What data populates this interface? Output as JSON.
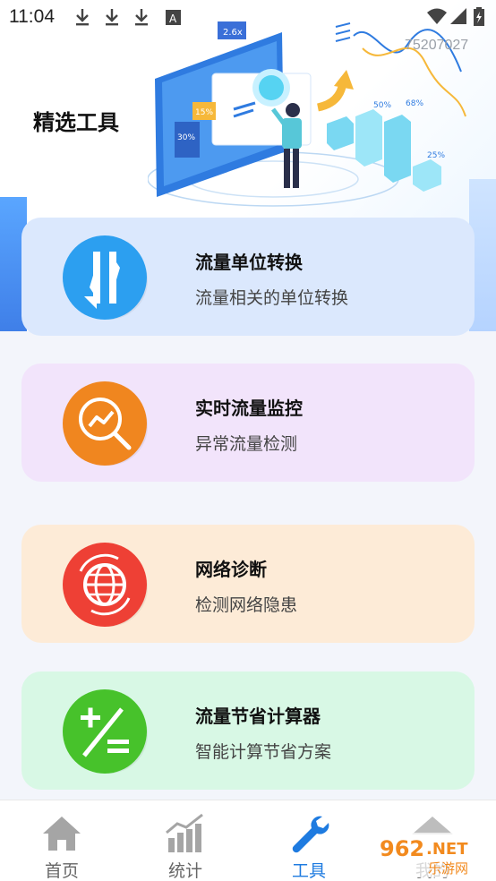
{
  "status_bar": {
    "time": "11:04",
    "left_icons": [
      "download-icon",
      "download-icon",
      "download-icon",
      "font-icon"
    ],
    "right_icons": [
      "wifi-icon",
      "signal-icon",
      "battery-icon"
    ]
  },
  "header": {
    "title": "精选工具",
    "code": "75207027"
  },
  "cards": [
    {
      "title": "流量单位转换",
      "desc": "流量相关的单位转换",
      "bg": "#dbe8fd",
      "icon_color": "#2c9ff0",
      "icon": "swap-arrows-icon"
    },
    {
      "title": "实时流量监控",
      "desc": "异常流量检测",
      "bg": "#f2e4fb",
      "icon_color": "#f0861f",
      "icon": "search-chart-icon"
    },
    {
      "title": "网络诊断",
      "desc": "检测网络隐患",
      "bg": "#fdebd7",
      "icon_color": "#ee4035",
      "icon": "globe-icon"
    },
    {
      "title": "流量节省计算器",
      "desc": "智能计算节省方案",
      "bg": "#d8f8e5",
      "icon_color": "#47c22b",
      "icon": "calculator-icon"
    }
  ],
  "nav": {
    "items": [
      {
        "label": "首页",
        "icon": "home-icon"
      },
      {
        "label": "统计",
        "icon": "stats-icon"
      },
      {
        "label": "工具",
        "icon": "wrench-icon"
      },
      {
        "label": "我的",
        "icon": "profile-icon"
      }
    ],
    "active_color": "#1e7be0",
    "inactive_color": "#9a9a9a"
  },
  "watermark": {
    "brand": "962.NET",
    "sub": "乐游网"
  }
}
